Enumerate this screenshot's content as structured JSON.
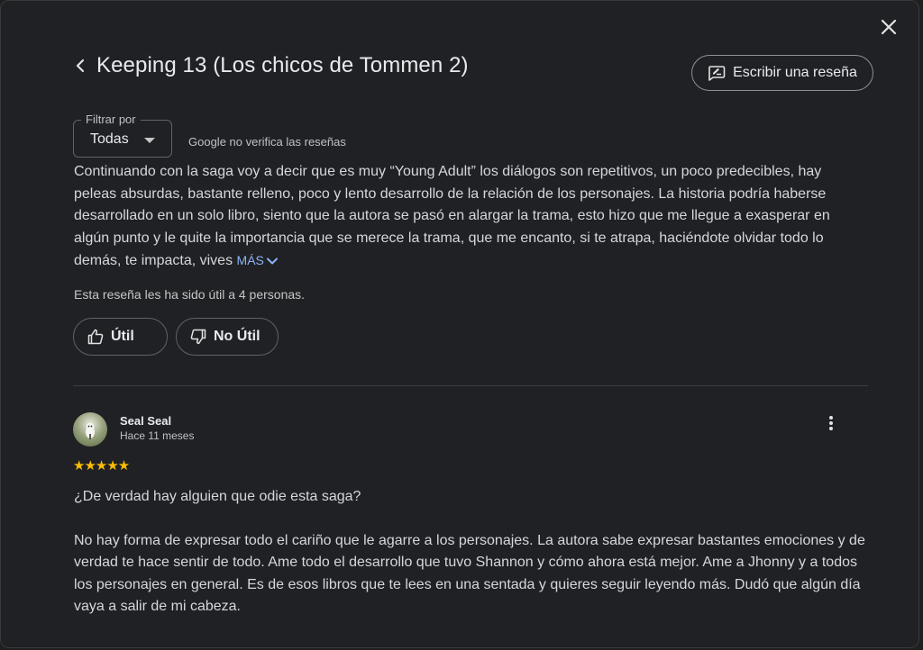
{
  "dialog": {
    "close_icon": "close-icon",
    "back_icon": "chevron-left-icon",
    "title": "Keeping 13 (Los chicos de Tommen 2)",
    "write_review_label": "Escribir una reseña",
    "write_review_icon": "rate-review-icon"
  },
  "filter": {
    "legend": "Filtrar por",
    "value": "Todas",
    "disclaimer": "Google no verifica las reseñas"
  },
  "review1": {
    "text": "Continuando con la saga voy a decir que es muy “Young Adult” los diálogos son repetitivos, un poco predecibles, hay peleas absurdas, bastante relleno, poco y lento desarrollo de la relación de los personajes. La historia podría haberse desarrollado en un solo libro, siento que la autora se pasó en alargar la trama, esto hizo que me llegue a exasperar en algún punto y le quite la importancia que se merece la trama, que me encanto, si te atrapa, haciéndote olvidar todo lo demás, te impacta, vives",
    "more_label": "MÁS",
    "helpful_count": "Esta reseña les ha sido útil a 4 personas.",
    "useful_label": "Útil",
    "not_useful_label": "No Útil"
  },
  "review2": {
    "author": "Seal Seal",
    "time": "Hace 11 meses",
    "rating": 5,
    "stars": "★★★★★",
    "line1": "¿De verdad hay alguien que odie esta saga?",
    "body": "No hay forma de expresar todo el cariño que le agarre a los personajes. La autora sabe expresar bastantes emociones y de verdad te hace sentir de todo. Ame todo el desarrollo que tuvo Shannon y cómo ahora está mejor. Ame a Jhonny y a todos los personajes en general. Es de esos libros que te lees en una sentada y quieres seguir leyendo más. Dudó que algún día vaya a salir de mi cabeza."
  },
  "colors": {
    "background": "#202124",
    "link": "#8ab4f8",
    "star": "#fbbc04"
  }
}
